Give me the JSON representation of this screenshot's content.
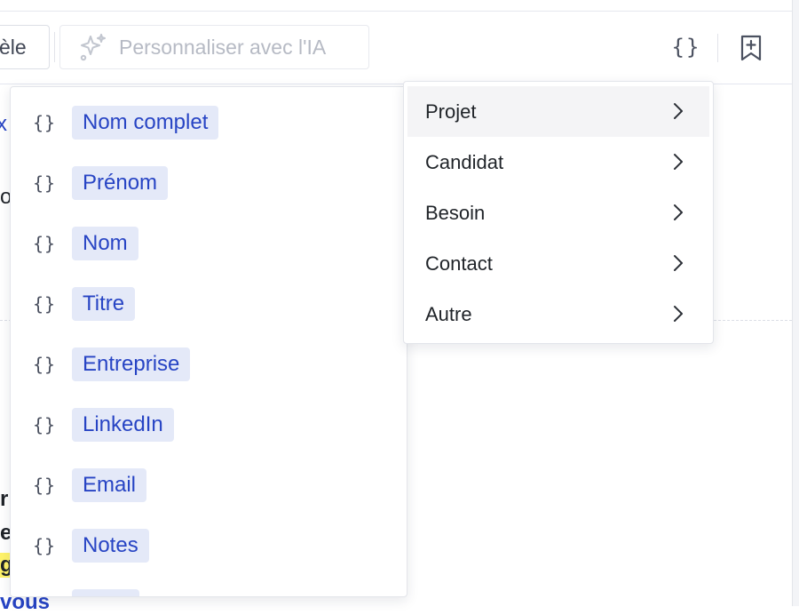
{
  "toolbar": {
    "model_label": "èle",
    "ai_button_label": "Personnaliser avec l'IA",
    "icons": [
      "sparkle-icon",
      "braces-icon",
      "bookmark-add-icon"
    ]
  },
  "variables_menu": {
    "items": [
      {
        "label": "Nom complet"
      },
      {
        "label": "Prénom"
      },
      {
        "label": "Nom"
      },
      {
        "label": "Titre"
      },
      {
        "label": "Entreprise"
      },
      {
        "label": "LinkedIn"
      },
      {
        "label": "Email"
      },
      {
        "label": "Notes"
      }
    ]
  },
  "categories_menu": {
    "items": [
      {
        "label": "Projet",
        "active": true
      },
      {
        "label": "Candidat"
      },
      {
        "label": "Besoin"
      },
      {
        "label": "Contact"
      },
      {
        "label": "Autre"
      }
    ]
  },
  "background_text": {
    "frag_blue": "x",
    "frag_o": "o",
    "frag_r": "r",
    "frag_e": "e",
    "frag_g": "g",
    "frag_vous": "vous"
  },
  "colors": {
    "chip_bg": "#e4e9f8",
    "chip_text": "#2744c4",
    "active_row_bg": "#f4f4f6"
  }
}
